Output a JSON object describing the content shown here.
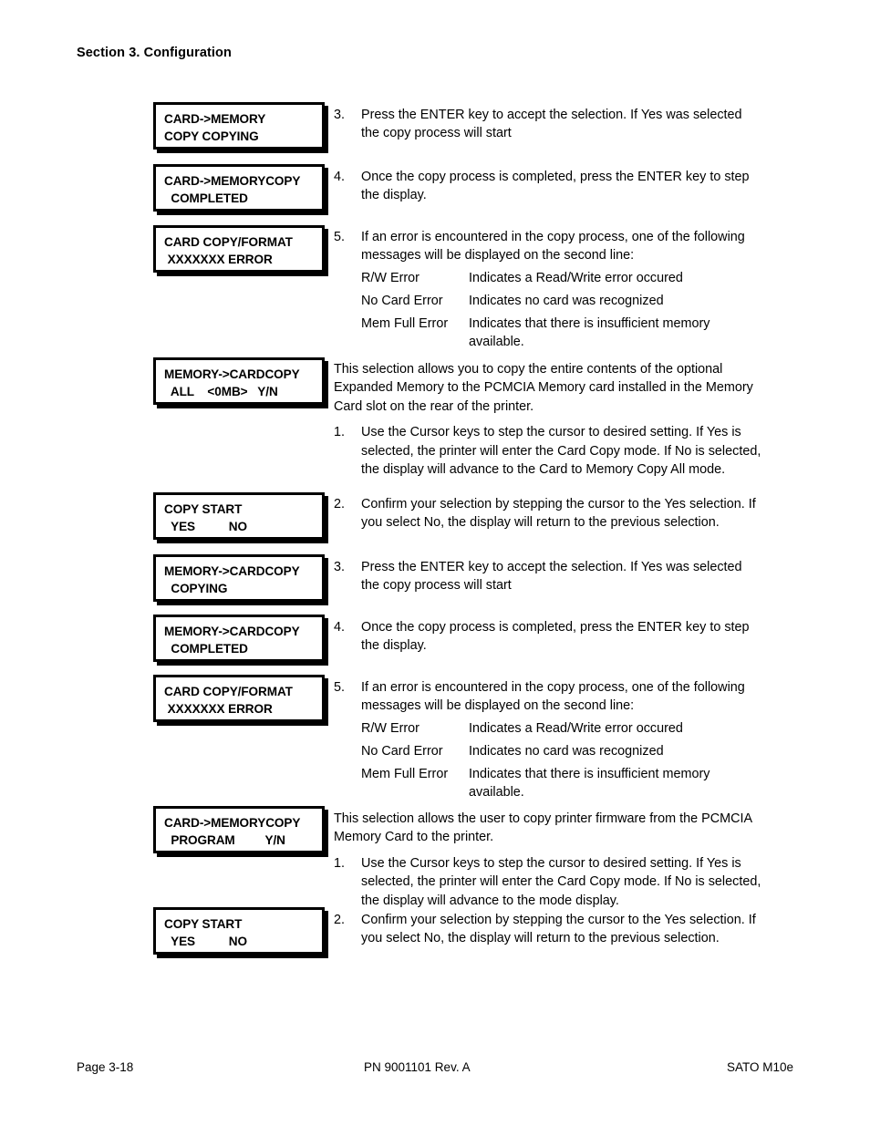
{
  "document": {
    "header": "Section 3. Configuration",
    "footer": {
      "left": "Page 3-18",
      "center": "PN 9001101 Rev. A",
      "right": "SATO M10e"
    }
  },
  "displays": {
    "card_memory_copying": {
      "line1": "CARD->MEMORY",
      "line2": "COPY COPYING"
    },
    "card_memorycopy_completed": {
      "line1": "CARD->MEMORYCOPY",
      "line2": "  COMPLETED"
    },
    "card_copy_format_error_1": {
      "line1": "CARD COPY/FORMAT",
      "line2": " XXXXXXX ERROR"
    },
    "memory_cardcopy_all": {
      "line1": "MEMORY->CARDCOPY",
      "line2": "  ALL    <0MB>   Y/N"
    },
    "copy_start_1": {
      "line1": "COPY START",
      "line2": "  YES          NO"
    },
    "memory_cardcopy_copying": {
      "line1": "MEMORY->CARDCOPY",
      "line2": "  COPYING"
    },
    "memory_cardcopy_completed": {
      "line1": "MEMORY->CARDCOPY",
      "line2": "  COMPLETED"
    },
    "card_copy_format_error_2": {
      "line1": "CARD COPY/FORMAT",
      "line2": " XXXXXXX ERROR"
    },
    "card_memorycopy_program": {
      "line1": "CARD->MEMORYCOPY",
      "line2": "  PROGRAM         Y/N"
    },
    "copy_start_2": {
      "line1": "COPY START",
      "line2": "  YES          NO"
    }
  },
  "steps": {
    "s1_step3": {
      "num": "3.",
      "text": "Press the ENTER key to accept the selection. If Yes was selected the copy process will start"
    },
    "s1_step4": {
      "num": "4.",
      "text": "Once the copy process is completed, press the ENTER key to step the display."
    },
    "s1_step5": {
      "num": "5.",
      "text": "If an error is encountered in the copy process, one of the following messages will be displayed on the second line:"
    },
    "s2_step1": {
      "num": "1.",
      "text": "Use the Cursor keys to step the cursor to desired setting. If Yes is selected, the printer will enter the Card Copy mode. If No is selected, the display will advance to the Card to Memory Copy All mode."
    },
    "s2_step2": {
      "num": "2.",
      "text": "Confirm your selection by stepping the cursor to the Yes selection. If you select No, the display will return to the previous selection."
    },
    "s2_step3": {
      "num": "3.",
      "text": "Press the ENTER key to accept the selection. If Yes was selected the copy process will start"
    },
    "s2_step4": {
      "num": "4.",
      "text": "Once the copy process is completed, press the ENTER key to step the display."
    },
    "s2_step5": {
      "num": "5.",
      "text": "If an error is encountered in the copy process, one of the following messages will be displayed on the second line:"
    },
    "s3_step1": {
      "num": "1.",
      "text": "Use the Cursor keys to step the cursor to desired setting. If Yes is selected, the printer will enter the Card Copy mode. If No is selected, the display will advance to the mode display."
    },
    "s3_step2": {
      "num": "2.",
      "text": "Confirm your selection by stepping the cursor to the Yes selection. If you select No, the display will return to the previous selection."
    }
  },
  "descriptions": {
    "memory_to_card": "This selection allows you to copy the entire contents of the optional Expanded Memory to the PCMCIA Memory card installed in the Memory Card slot on the rear of the printer.",
    "card_to_memory_program": "This selection allows the user to copy printer firmware from the PCMCIA Memory Card to the printer."
  },
  "error_table_1": {
    "rows": [
      {
        "term": "R/W Error",
        "definition": "Indicates a Read/Write error occured"
      },
      {
        "term": "No Card Error",
        "definition": "Indicates no card was recognized"
      },
      {
        "term": "Mem Full Error",
        "definition": "Indicates that there is insufficient memory available."
      }
    ]
  },
  "error_table_2": {
    "rows": [
      {
        "term": "R/W Error",
        "definition": "Indicates a Read/Write error occured"
      },
      {
        "term": "No Card Error",
        "definition": "Indicates no card was recognized"
      },
      {
        "term": "Mem Full Error",
        "definition": "Indicates that there is insufficient memory available."
      }
    ]
  }
}
